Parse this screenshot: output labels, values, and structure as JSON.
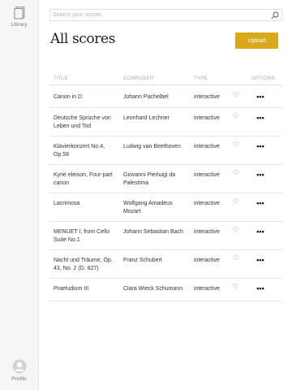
{
  "sidebar": {
    "library_label": "Library",
    "library_icon": "library-icon",
    "profile_label": "Profile",
    "profile_icon": "avatar-icon"
  },
  "search": {
    "placeholder": "Search your scores",
    "value": "",
    "icon": "search-icon"
  },
  "header": {
    "title": "All scores",
    "upload_label": "Upload",
    "upload_color": "#d8a91c"
  },
  "table": {
    "columns": [
      "TITLE",
      "COMPOSER",
      "TYPE",
      "OPTIONS"
    ],
    "rows": [
      {
        "title": "Canon in D",
        "composer": "Johann Pachelbel",
        "type": "interactive",
        "options": "•••"
      },
      {
        "title": "Deutsche Sprüche von Leben und Tod",
        "composer": "Leonhard Lechner",
        "type": "interactive",
        "options": "•••"
      },
      {
        "title": "Klavierkonzert No.4, Op.58",
        "composer": "Ludwig van Beethoven",
        "type": "interactive",
        "options": "•••"
      },
      {
        "title": "Kyrie eleison, Four-part canon",
        "composer": "Giovanni Pierluigi da Palestrina",
        "type": "interactive",
        "options": "•••"
      },
      {
        "title": "Lacrimosa",
        "composer": "Wolfgang Amadeus Mozart",
        "type": "interactive",
        "options": "•••"
      },
      {
        "title": "MENUET I, from Cello Suite No.1",
        "composer": "Johann Sebastian Bach",
        "type": "interactive",
        "options": "•••"
      },
      {
        "title": "Nacht und Träume, Op. 43, No. 2 (D. 827)",
        "composer": "Franz Schubert",
        "type": "interactive",
        "options": "•••"
      },
      {
        "title": "Praeludium III",
        "composer": "Clara Wieck Schumann",
        "type": "interactive",
        "options": "•••"
      }
    ]
  }
}
